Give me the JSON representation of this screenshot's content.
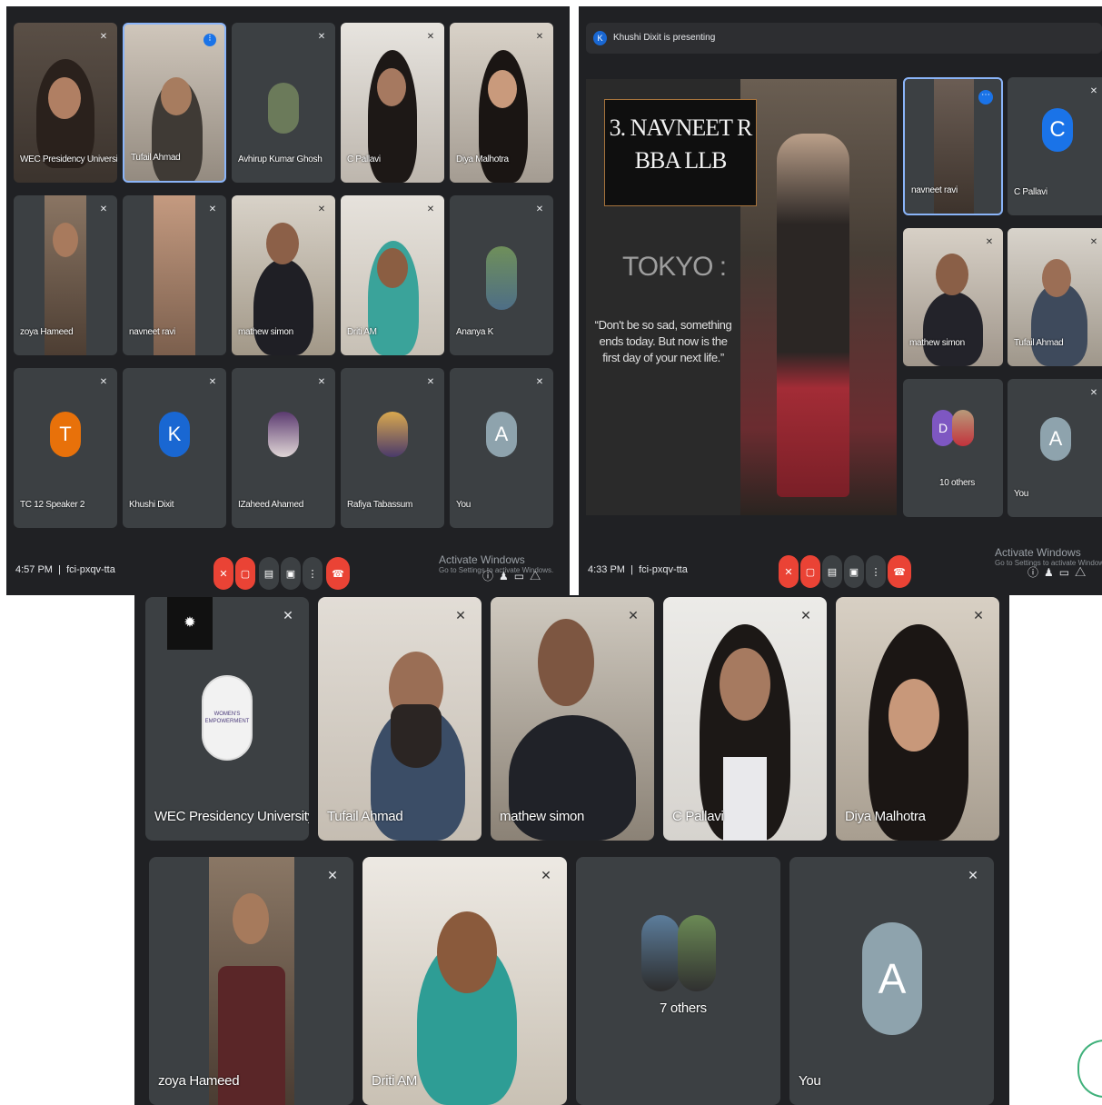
{
  "panel1": {
    "tiles": [
      {
        "name": "WEC Presidency University"
      },
      {
        "name": "Tufail Ahmad"
      },
      {
        "name": "Avhirup Kumar Ghosh"
      },
      {
        "name": "C Pallavi"
      },
      {
        "name": "Diya Malhotra"
      },
      {
        "name": "zoya Hameed"
      },
      {
        "name": "navneet ravi"
      },
      {
        "name": "mathew simon"
      },
      {
        "name": "Driti AM"
      },
      {
        "name": "Ananya K"
      },
      {
        "name": "TC 12 Speaker 2",
        "initial": "T",
        "color": "#e8710a"
      },
      {
        "name": "Khushi Dixit",
        "initial": "K",
        "color": "#1967d2"
      },
      {
        "name": "IZaheed Ahamed"
      },
      {
        "name": "Rafiya Tabassum"
      },
      {
        "name": "You",
        "initial": "A",
        "color": "#8ea3ad"
      }
    ],
    "time": "4:57 PM",
    "meeting_code": "fci-pxqv-tta",
    "activate_title": "Activate Windows",
    "activate_sub": "Go to Settings to activate Windows."
  },
  "panel2": {
    "presenter_initial": "K",
    "presenting_label": "Khushi Dixit is presenting",
    "slide": {
      "title_line1": "3. NAVNEET R",
      "title_line2": "BBA LLB",
      "heading": "TOKYO :",
      "quote": "“Don't be so sad, something ends today. But now is the first day of your next life.”"
    },
    "tiles": [
      {
        "name": "navneet ravi"
      },
      {
        "name": "C Pallavi",
        "initial": "C",
        "color": "#1a73e8"
      },
      {
        "name": "mathew simon"
      },
      {
        "name": "Tufail Ahmad"
      },
      {
        "name": "10 others",
        "initial": "D",
        "color": "#7e57c2"
      },
      {
        "name": "You",
        "initial": "A",
        "color": "#8ea3ad"
      }
    ],
    "time": "4:33 PM",
    "meeting_code": "fci-pxqv-tta",
    "activate_title": "Activate Windows",
    "activate_sub": "Go to Settings to activate Windows."
  },
  "panel3": {
    "tiles": [
      {
        "name": "WEC Presidency University",
        "logo_text": "WOMEN'S EMPOWERMENT"
      },
      {
        "name": "Tufail Ahmad"
      },
      {
        "name": "mathew simon"
      },
      {
        "name": "C Pallavi"
      },
      {
        "name": "Diya Malhotra"
      },
      {
        "name": "zoya Hameed"
      },
      {
        "name": "Driti AM"
      },
      {
        "name": "7 others"
      },
      {
        "name": "You",
        "initial": "A",
        "color": "#8ea3ad"
      }
    ]
  },
  "icons": {
    "mic_off": "mic-off-icon",
    "camera_off": "camera-off-icon",
    "captions": "captions-icon",
    "present": "present-icon",
    "more": "more-icon",
    "end_call": "end-call-icon",
    "info": "info-icon",
    "people": "people-icon",
    "chat": "chat-icon",
    "activities": "activities-icon",
    "brightness": "brightness-icon",
    "pin": "pin-icon"
  },
  "colors": {
    "background": "#202124",
    "tile": "#3c4043",
    "red": "#ea4335",
    "blue": "#1a73e8"
  }
}
